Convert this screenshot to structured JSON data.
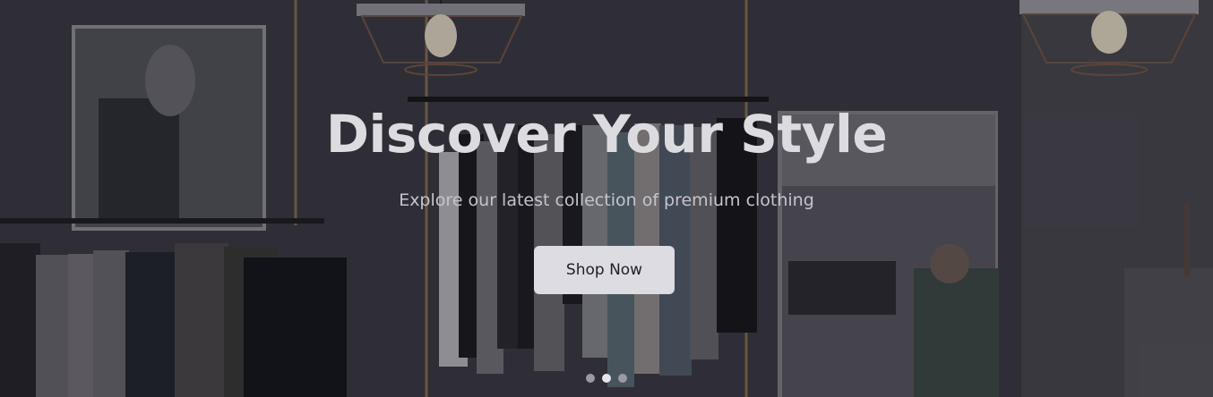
{
  "hero": {
    "title": "Discover Your Style",
    "subtitle": "Explore our latest collection of premium clothing",
    "cta_label": "Shop Now"
  },
  "carousel": {
    "slide_count": 3,
    "active_index": 1
  },
  "colors": {
    "title_text": "#dcdce0",
    "subtitle_text": "#c4c4cc",
    "button_bg": "#dcdce2",
    "button_text": "#1f1f28",
    "dot_active": "#e6e6ea",
    "dot_inactive": "#9a9aa6"
  }
}
